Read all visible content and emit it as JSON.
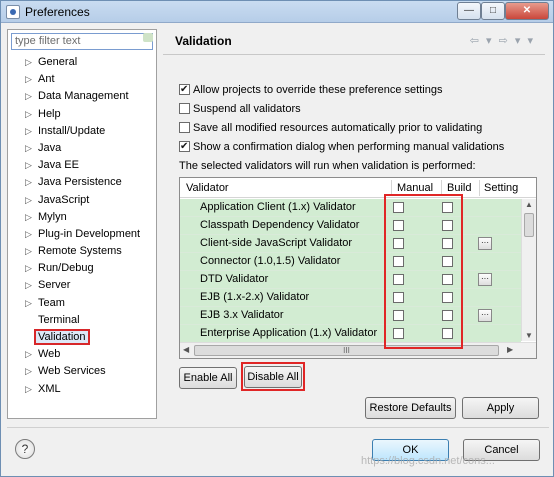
{
  "window": {
    "title": "Preferences",
    "min_glyph": "—",
    "max_glyph": "□",
    "close_glyph": "✕"
  },
  "filter": {
    "placeholder": "type filter text"
  },
  "tree": [
    {
      "label": "General",
      "expandable": true
    },
    {
      "label": "Ant",
      "expandable": true
    },
    {
      "label": "Data Management",
      "expandable": true
    },
    {
      "label": "Help",
      "expandable": true
    },
    {
      "label": "Install/Update",
      "expandable": true
    },
    {
      "label": "Java",
      "expandable": true
    },
    {
      "label": "Java EE",
      "expandable": true
    },
    {
      "label": "Java Persistence",
      "expandable": true
    },
    {
      "label": "JavaScript",
      "expandable": true
    },
    {
      "label": "Mylyn",
      "expandable": true
    },
    {
      "label": "Plug-in Development",
      "expandable": true
    },
    {
      "label": "Remote Systems",
      "expandable": true
    },
    {
      "label": "Run/Debug",
      "expandable": true
    },
    {
      "label": "Server",
      "expandable": true
    },
    {
      "label": "Team",
      "expandable": true
    },
    {
      "label": "Terminal",
      "expandable": false
    },
    {
      "label": "Validation",
      "expandable": false,
      "selected": true
    },
    {
      "label": "Web",
      "expandable": true
    },
    {
      "label": "Web Services",
      "expandable": true
    },
    {
      "label": "XML",
      "expandable": true
    }
  ],
  "page": {
    "title": "Validation",
    "nav": "⇦ ▾ ⇨ ▾ ▾"
  },
  "options": [
    {
      "label": "Allow projects to override these preference settings",
      "checked": true
    },
    {
      "label": "Suspend all validators",
      "checked": false
    },
    {
      "label": "Save all modified resources automatically prior to validating",
      "checked": false
    },
    {
      "label": "Show a confirmation dialog when performing manual validations",
      "checked": true
    }
  ],
  "description": "The selected validators will run when validation is performed:",
  "table": {
    "headers": {
      "validator": "Validator",
      "manual": "Manual",
      "build": "Build",
      "settings": "Setting"
    },
    "rows": [
      {
        "name": "Application Client (1.x) Validator",
        "settings": false
      },
      {
        "name": "Classpath Dependency Validator",
        "settings": false
      },
      {
        "name": "Client-side JavaScript Validator",
        "settings": true
      },
      {
        "name": "Connector (1.0,1.5) Validator",
        "settings": false
      },
      {
        "name": "DTD Validator",
        "settings": true
      },
      {
        "name": "EJB (1.x-2.x) Validator",
        "settings": false
      },
      {
        "name": "EJB 3.x Validator",
        "settings": true
      },
      {
        "name": "Enterprise Application (1.x) Validator",
        "settings": false
      }
    ],
    "settings_glyph": "···",
    "scroll_glyphs": {
      "up": "▲",
      "down": "▼",
      "left": "◀",
      "right": "▶",
      "grip": "III"
    }
  },
  "buttons": {
    "enable_all": "Enable All",
    "disable_all": "Disable All",
    "restore_defaults": "Restore Defaults",
    "apply": "Apply",
    "ok": "OK",
    "cancel": "Cancel",
    "help": "?"
  },
  "watermark": "https://blog.csdn.net/cons..."
}
